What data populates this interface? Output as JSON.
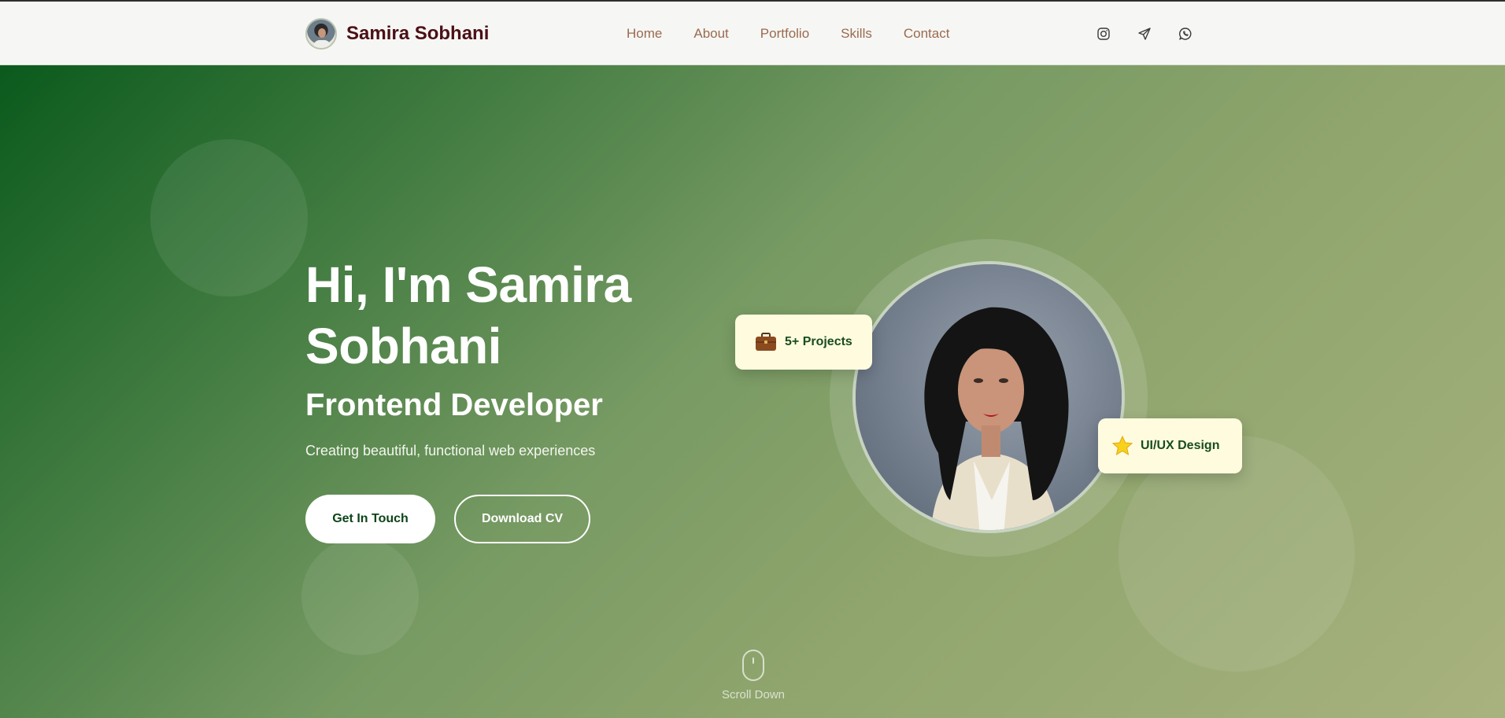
{
  "brand": {
    "name": "Samira Sobhani",
    "avatar_icon": "avatar-icon"
  },
  "nav": {
    "items": [
      {
        "label": "Home"
      },
      {
        "label": "About"
      },
      {
        "label": "Portfolio"
      },
      {
        "label": "Skills"
      },
      {
        "label": "Contact"
      }
    ]
  },
  "socials": [
    {
      "icon": "instagram-icon"
    },
    {
      "icon": "telegram-icon"
    },
    {
      "icon": "whatsapp-icon"
    }
  ],
  "hero": {
    "title": "Hi, I'm Samira Sobhani",
    "role": "Frontend Developer",
    "subtitle": "Creating beautiful, functional web experiences",
    "primary_button": "Get In Touch",
    "secondary_button": "Download CV"
  },
  "badges": {
    "projects": {
      "label": "5+ Projects",
      "icon": "briefcase-icon"
    },
    "uiux": {
      "label": "UI/UX Design",
      "icon": "star-icon"
    }
  },
  "scroll": {
    "label": "Scroll Down"
  },
  "colors": {
    "brand_text": "#4b1016",
    "nav_link": "#9b6a4f",
    "hero_gradient_start": "#0b5a1d",
    "hero_gradient_end": "#a8b27f",
    "badge_bg": "#fffbdf",
    "badge_text": "#184d1f"
  }
}
